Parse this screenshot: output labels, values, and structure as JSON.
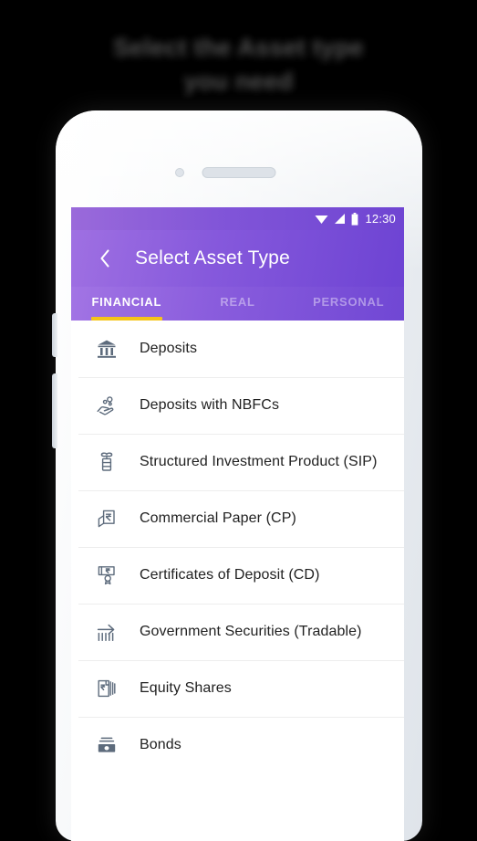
{
  "caption": {
    "line1": "Select the Asset type",
    "line2": "you need"
  },
  "colors": {
    "header_gradient_start": "#9f70e2",
    "header_gradient_end": "#6d43d3",
    "tab_indicator": "#f5c518",
    "icon": "#5d6b7c",
    "text_primary": "#212121",
    "divider": "#ededed"
  },
  "statusbar": {
    "time": "12:30",
    "icons": [
      "wifi-icon",
      "signal-icon",
      "battery-icon"
    ]
  },
  "appbar": {
    "back_icon": "chevron-left-icon",
    "title": "Select Asset Type"
  },
  "tabs": {
    "items": [
      {
        "label": "FINANCIAL",
        "active": true
      },
      {
        "label": "REAL",
        "active": false
      },
      {
        "label": "PERSONAL",
        "active": false
      }
    ]
  },
  "list": {
    "items": [
      {
        "label": "Deposits",
        "icon": "bank-icon"
      },
      {
        "label": "Deposits with NBFCs",
        "icon": "hand-coins-icon"
      },
      {
        "label": "Structured Investment Product (SIP)",
        "icon": "sip-stack-icon"
      },
      {
        "label": "Commercial Paper (CP)",
        "icon": "rupee-document-icon"
      },
      {
        "label": "Certificates of Deposit (CD)",
        "icon": "certificate-seal-icon"
      },
      {
        "label": "Government Securities (Tradable)",
        "icon": "growth-arrow-icon"
      },
      {
        "label": "Equity Shares",
        "icon": "rupee-notes-icon"
      },
      {
        "label": "Bonds",
        "icon": "cash-bundle-icon"
      }
    ]
  }
}
